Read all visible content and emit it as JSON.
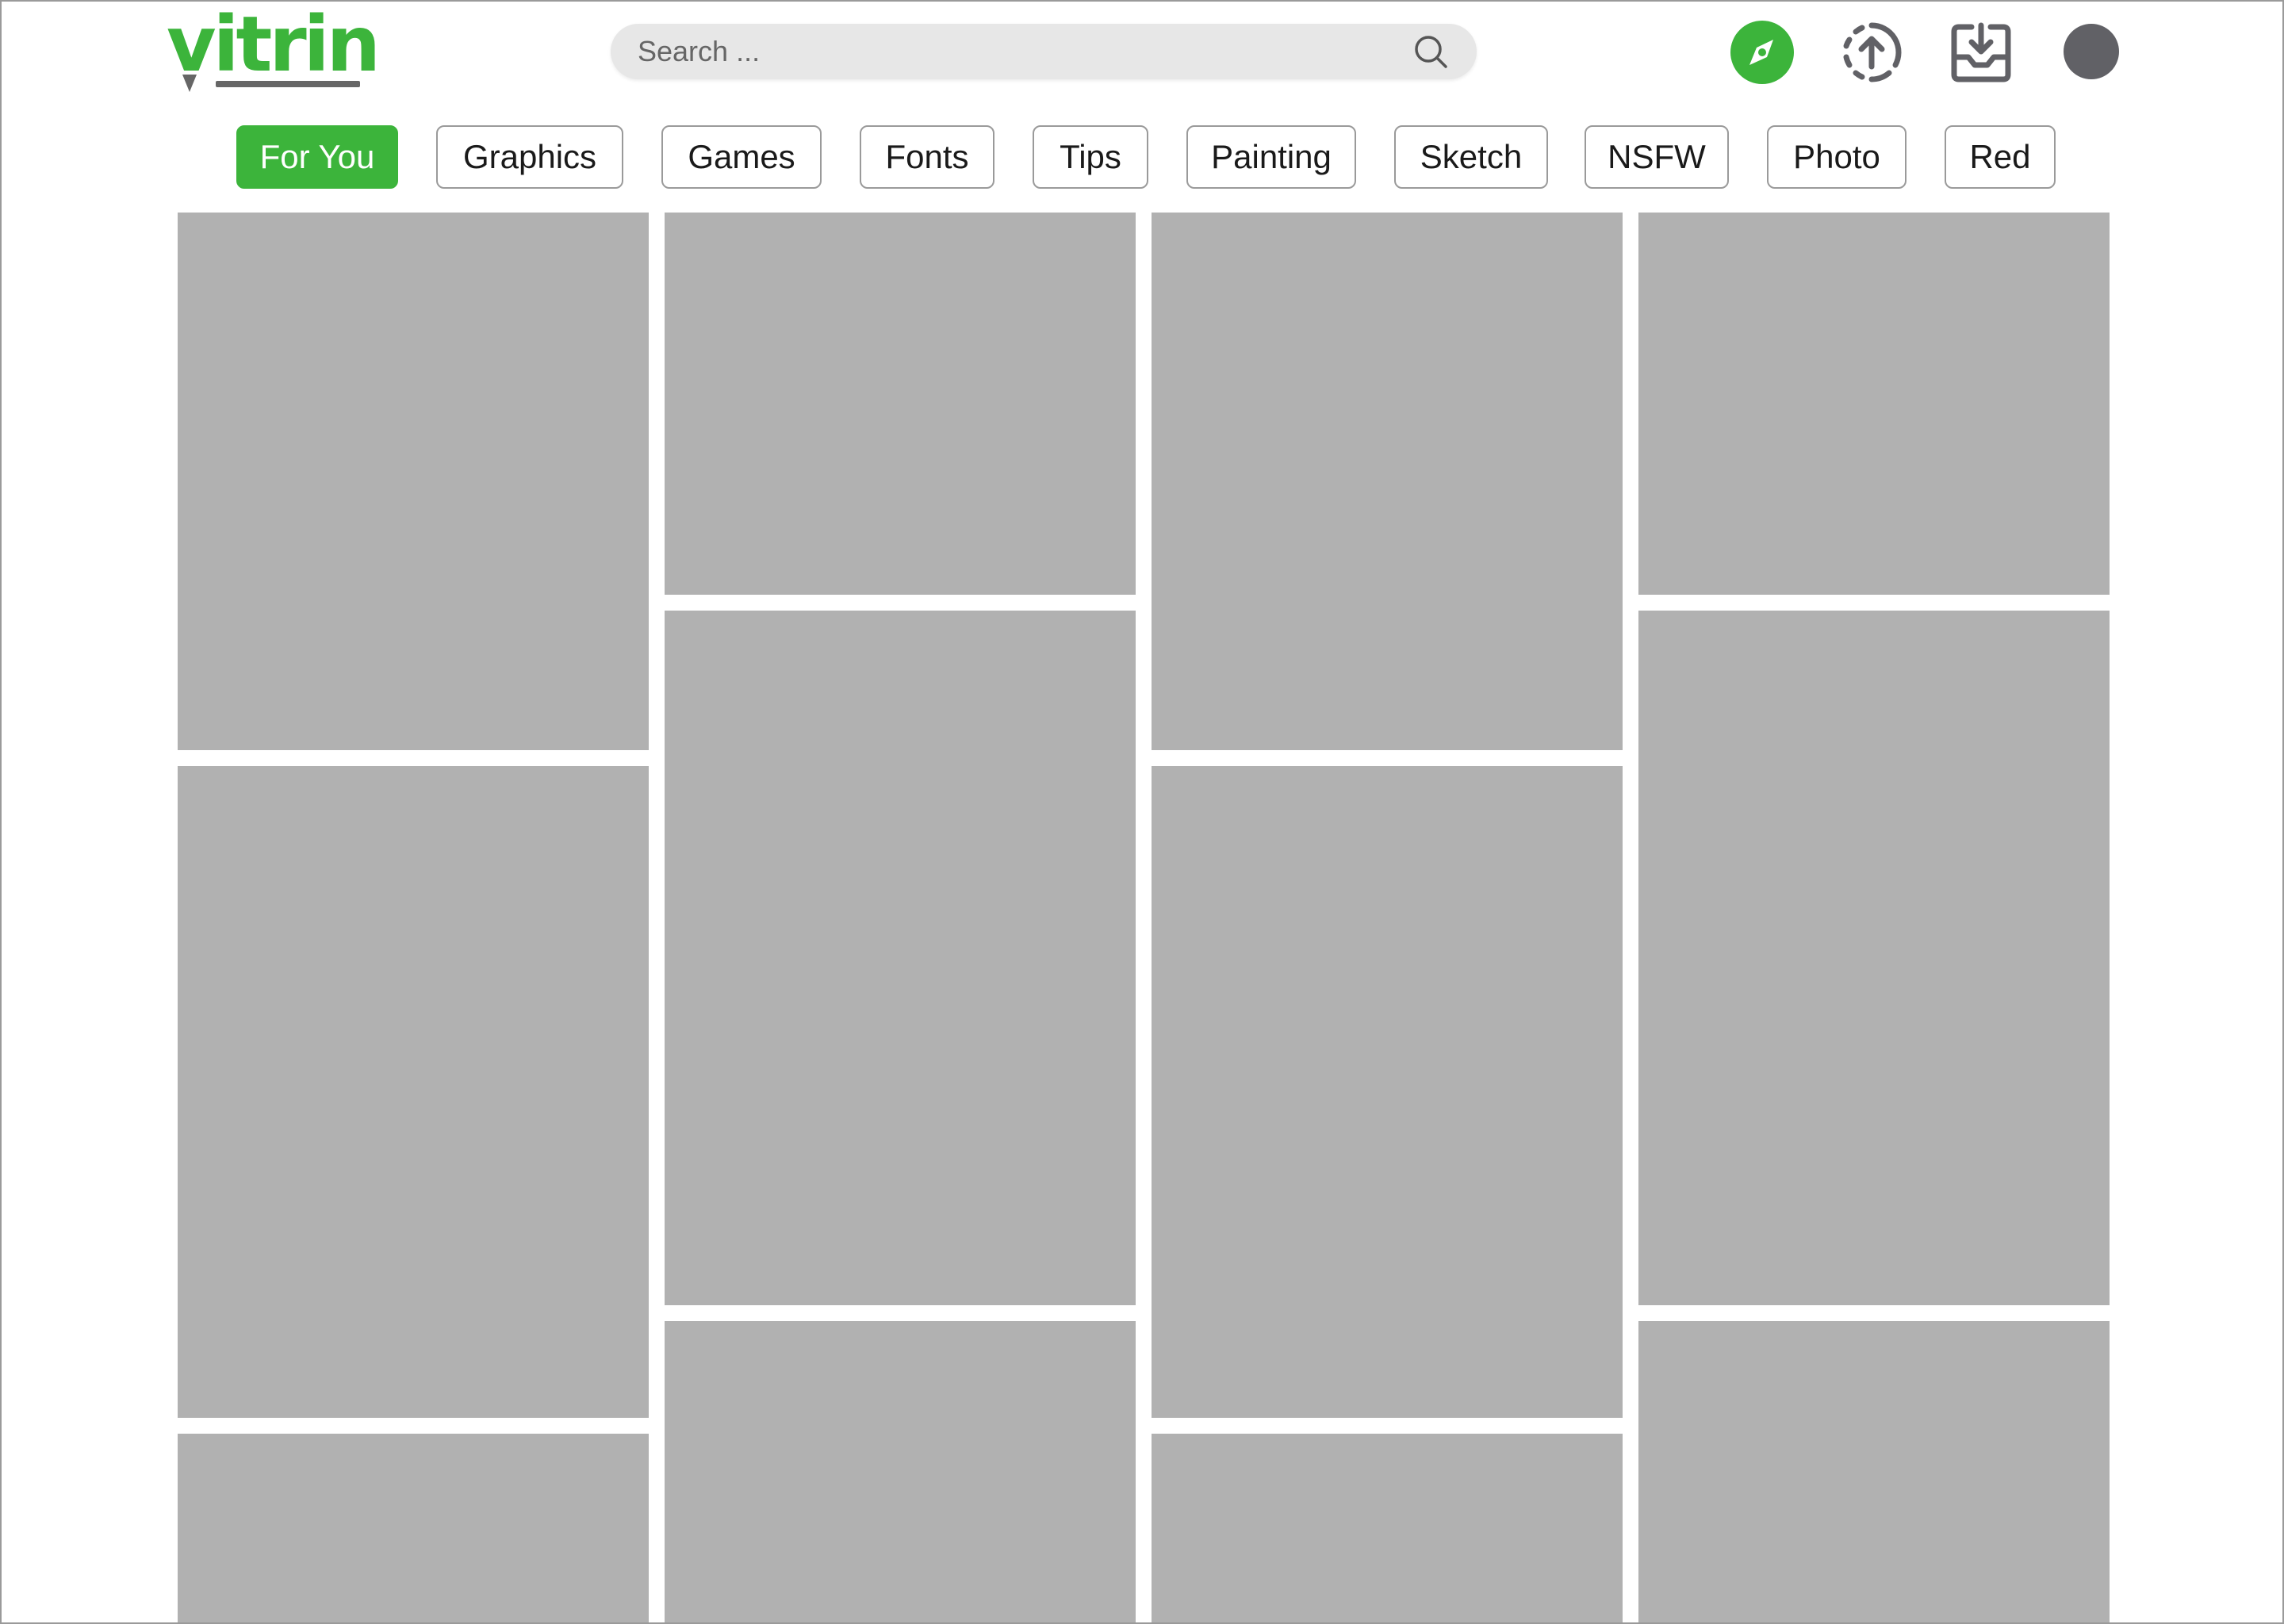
{
  "header": {
    "logo_text": "vitrin",
    "search": {
      "placeholder": "Search ...",
      "value": ""
    },
    "icons": [
      "compass-icon",
      "upload-icon",
      "download-inbox-icon",
      "avatar"
    ]
  },
  "categories": [
    {
      "label": "For You",
      "active": true
    },
    {
      "label": "Graphics",
      "active": false
    },
    {
      "label": "Games",
      "active": false
    },
    {
      "label": "Fonts",
      "active": false
    },
    {
      "label": "Tips",
      "active": false
    },
    {
      "label": "Painting",
      "active": false
    },
    {
      "label": "Sketch",
      "active": false
    },
    {
      "label": "NSFW",
      "active": false
    },
    {
      "label": "Photo",
      "active": false
    },
    {
      "label": "Red",
      "active": false
    }
  ],
  "colors": {
    "accent": "#3cb43b",
    "tile_placeholder": "#b1b1b1",
    "icon_gray": "#616166",
    "search_bg": "#e7e7e7"
  }
}
